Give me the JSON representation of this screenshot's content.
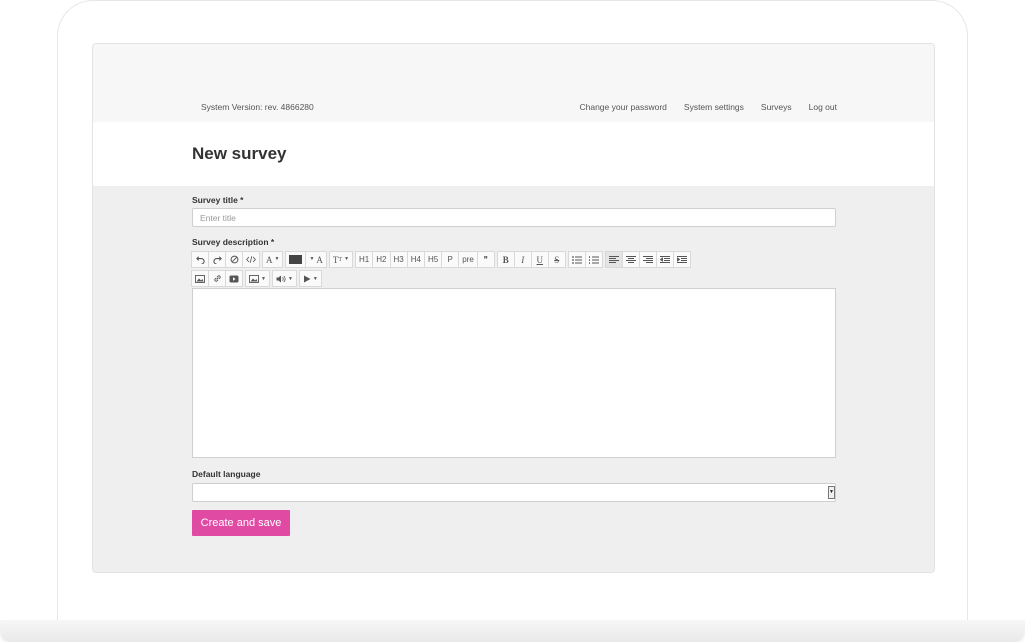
{
  "header": {
    "system_version": "System Version: rev. 4866280",
    "nav": {
      "change_password": "Change your password",
      "system_settings": "System settings",
      "surveys": "Surveys",
      "log_out": "Log out"
    }
  },
  "page": {
    "title": "New survey"
  },
  "form": {
    "survey_title_label": "Survey title *",
    "survey_title_placeholder": "Enter title",
    "survey_title_value": "",
    "survey_description_label": "Survey description *",
    "default_language_label": "Default language",
    "default_language_value": "",
    "submit_label": "Create and save"
  },
  "toolbar": {
    "font_button": "A",
    "forecolor_button": "A",
    "fontsize_button": "T",
    "headings": [
      "H1",
      "H2",
      "H3",
      "H4",
      "H5"
    ],
    "paragraph": "P",
    "preformatted": "pre",
    "blockquote": "❞",
    "bold": "B",
    "italic": "I",
    "underline": "U",
    "strikethrough": "S",
    "active_alignment": "align-left",
    "text_color": "#444444"
  },
  "colors": {
    "accent": "#e04aa3",
    "page_background": "#efefef",
    "header_background": "#f7f7f7"
  }
}
